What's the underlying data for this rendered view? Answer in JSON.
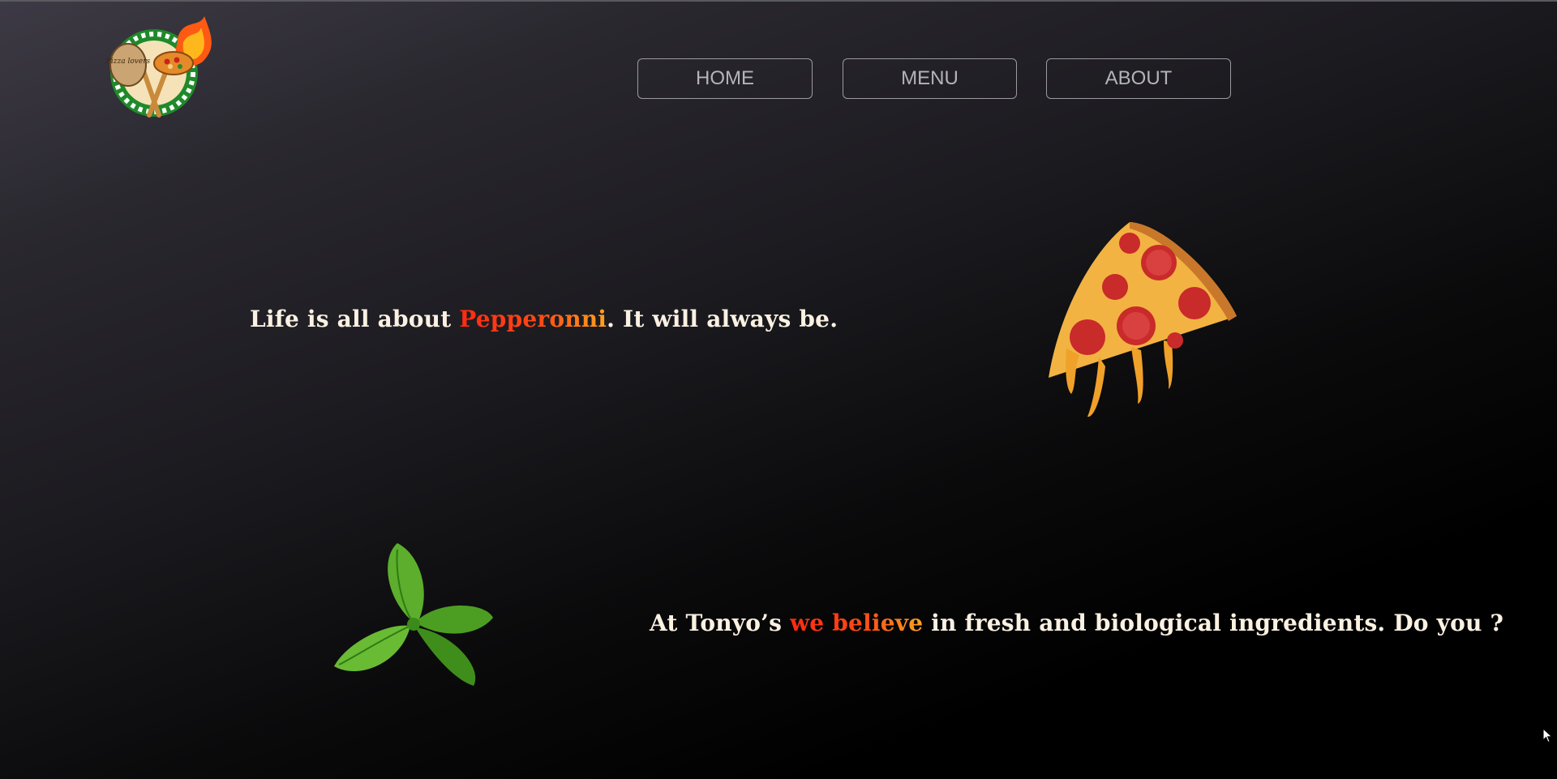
{
  "header": {
    "logo_icon": "pizza-flame-logo-icon",
    "logo_text": "Pizza lovers",
    "nav": [
      {
        "label": "HOME"
      },
      {
        "label": "MENU"
      },
      {
        "label": "ABOUT"
      }
    ]
  },
  "section1": {
    "text_before": "Life is all about ",
    "accent": "Pepperonni",
    "text_after": ". It will always be.",
    "image_icon": "pepperoni-pizza-slice-icon"
  },
  "section2": {
    "text_before": "At Tonyo’s ",
    "accent": "we believe",
    "text_after": " in fresh and biological ingredients. Do you ?",
    "image_icon": "basil-leaves-icon"
  },
  "colors": {
    "accent_start": "#ff2a12",
    "accent_end": "#ffa320",
    "text": "#fbf1e2"
  }
}
